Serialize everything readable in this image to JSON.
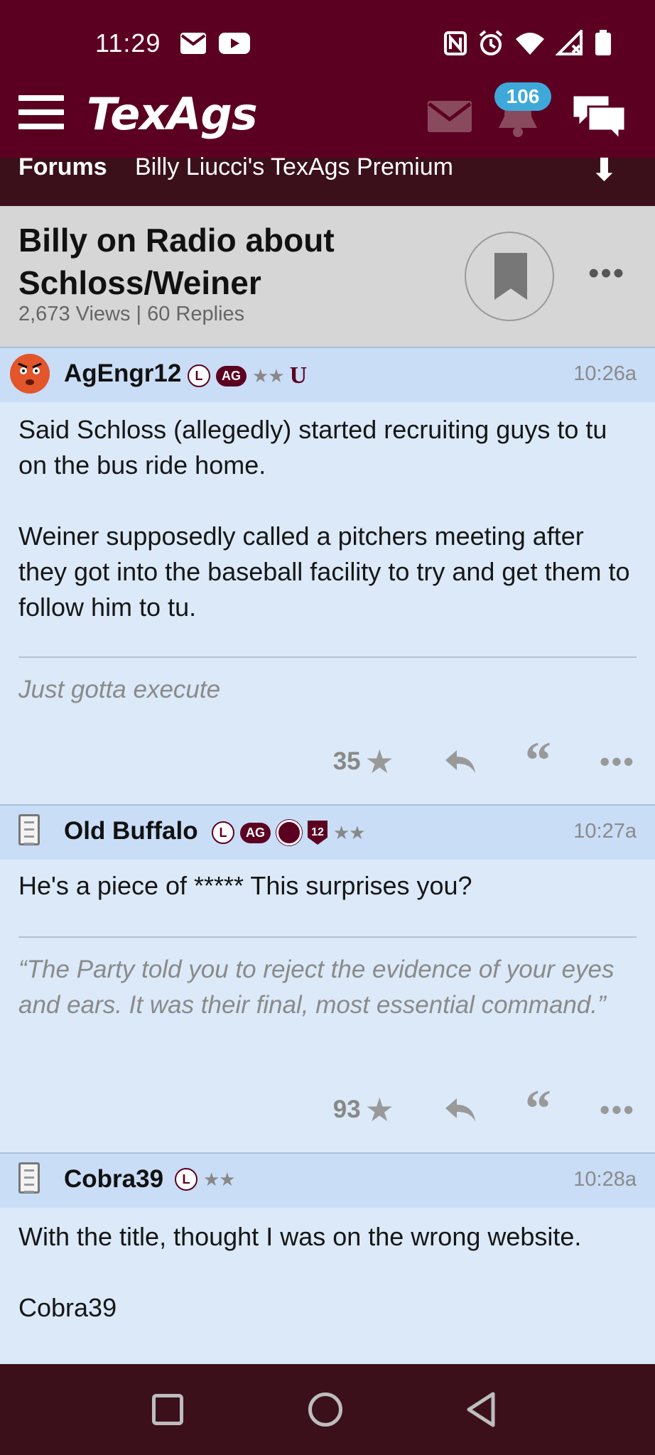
{
  "status_bar": {
    "time": "11:29",
    "left_icons": [
      "mail-icon",
      "youtube-icon"
    ],
    "right_icons": [
      "nfc-icon",
      "alarm-icon",
      "wifi-icon",
      "signal-off-icon",
      "battery-icon"
    ]
  },
  "app_bar": {
    "logo": "TexAgs",
    "notification_count": "106",
    "icons": [
      "menu-icon",
      "messages-icon",
      "notifications-bell-icon",
      "chat-icon"
    ]
  },
  "subnav": {
    "section": "Forums",
    "board": "Billy Liucci's TexAgs Premium",
    "jump_icon": "arrow-down-icon"
  },
  "thread": {
    "title": "Billy on Radio about Schloss/Weiner",
    "meta": "2,673 Views | 60 Replies"
  },
  "posts": [
    {
      "username": "AgEngr12",
      "time": "10:26a",
      "badges": [
        "L",
        "AG",
        "★★",
        "U"
      ],
      "body": [
        "Said Schloss (allegedly) started recruiting guys to tu on the bus ride home.",
        "Weiner supposedly called a pitchers meeting after they got into the baseball facility to try and get them to follow him to tu."
      ],
      "signature": "Just gotta execute",
      "stars": "35"
    },
    {
      "username": "Old Buffalo",
      "time": "10:27a",
      "badges": [
        "L",
        "AG",
        "12",
        "★★"
      ],
      "body": [
        "He's a piece of ***** This surprises you?"
      ],
      "signature": "“The Party told you to reject the evidence of your eyes and ears. It was their final, most essential command.”",
      "stars": "93"
    },
    {
      "username": "Cobra39",
      "time": "10:28a",
      "badges": [
        "L",
        "★★"
      ],
      "body": [
        "With the title, thought I was on the wrong website.",
        "Cobra39"
      ]
    }
  ],
  "colors": {
    "maroon": "#5c0021",
    "dark_maroon": "#3b101b",
    "post_bg": "#dbe9f8",
    "post_header_bg": "#c9ddf6",
    "badge_blue": "#3ea9d9"
  }
}
